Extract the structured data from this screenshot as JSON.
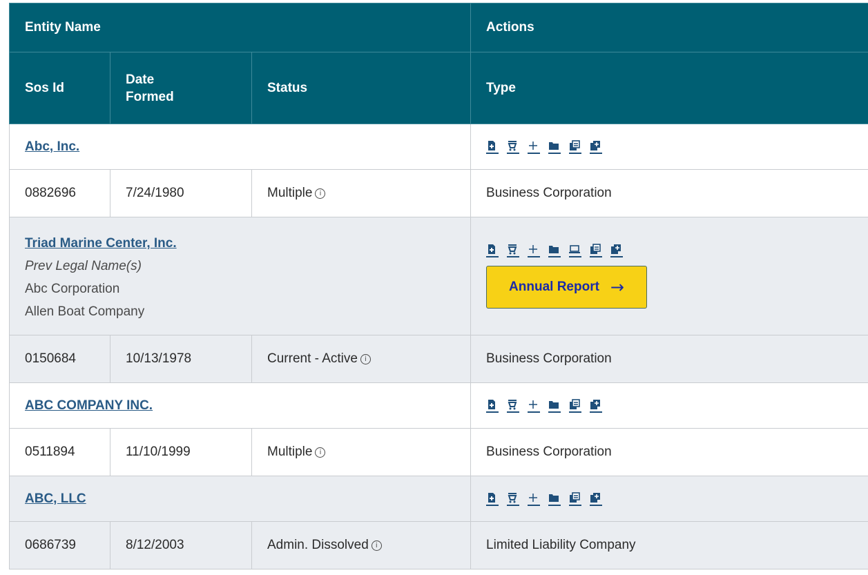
{
  "header": {
    "entity_name": "Entity Name",
    "actions": "Actions",
    "sos_id": "Sos Id",
    "date_formed_line1": "Date",
    "date_formed_line2": "Formed",
    "status": "Status",
    "type": "Type"
  },
  "rows": [
    {
      "name": "Abc, Inc.",
      "sos_id": "0882696",
      "date_formed": "7/24/1980",
      "status": "Multiple",
      "type": "Business Corporation",
      "actions": [
        "file-icon",
        "cart-icon",
        "plus-icon",
        "folder-icon",
        "copy-icon",
        "add-copy-icon"
      ]
    },
    {
      "name": "Triad Marine Center, Inc.",
      "prev_label": "Prev Legal Name(s)",
      "prev_names": [
        "Abc Corporation",
        "Allen Boat Company"
      ],
      "sos_id": "0150684",
      "date_formed": "10/13/1978",
      "status": "Current - Active",
      "type": "Business Corporation",
      "actions": [
        "file-icon",
        "cart-icon",
        "plus-icon",
        "folder-icon",
        "laptop-icon",
        "copy-icon",
        "add-copy-icon"
      ],
      "button": "Annual Report"
    },
    {
      "name": "ABC COMPANY INC.",
      "sos_id": "0511894",
      "date_formed": "11/10/1999",
      "status": "Multiple",
      "type": "Business Corporation",
      "actions": [
        "file-icon",
        "cart-icon",
        "plus-icon",
        "folder-icon",
        "copy-icon",
        "add-copy-icon"
      ]
    },
    {
      "name": "ABC, LLC",
      "sos_id": "0686739",
      "date_formed": "8/12/2003",
      "status": "Admin. Dissolved",
      "type": "Limited Liability Company",
      "actions": [
        "file-icon",
        "cart-icon",
        "plus-icon",
        "folder-icon",
        "copy-icon",
        "add-copy-icon"
      ]
    }
  ],
  "colors": {
    "header_bg": "#005f73",
    "link": "#2a5b86",
    "button_bg": "#f7d116",
    "button_text": "#1a2aa8",
    "shaded_row": "#eaedf1"
  }
}
